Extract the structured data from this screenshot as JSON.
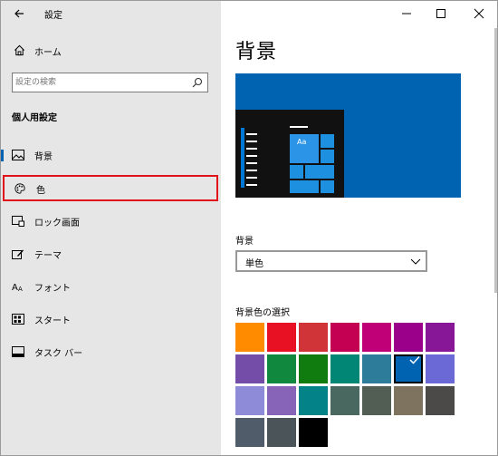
{
  "window": {
    "app_title": "設定",
    "controls": {
      "minimize": "minimize-icon",
      "maximize": "maximize-icon",
      "close": "close-icon"
    }
  },
  "sidebar": {
    "home_label": "ホーム",
    "search_placeholder": "設定の検索",
    "section_title": "個人用設定",
    "items": [
      {
        "label": "背景",
        "icon": "image-icon"
      },
      {
        "label": "色",
        "icon": "palette-icon",
        "highlighted": true
      },
      {
        "label": "ロック画面",
        "icon": "lock-screen-icon"
      },
      {
        "label": "テーマ",
        "icon": "theme-icon"
      },
      {
        "label": "フォント",
        "icon": "font-icon"
      },
      {
        "label": "スタート",
        "icon": "start-icon"
      },
      {
        "label": "タスク バー",
        "icon": "taskbar-icon"
      }
    ]
  },
  "main": {
    "page_title": "背景",
    "preview": {
      "tile_text": "Aa",
      "accent": "#0063b1"
    },
    "background_label": "背景",
    "background_value": "単色",
    "colors_label": "背景色の選択",
    "colors": [
      [
        "#ff8c00",
        "#e81123",
        "#d13438",
        "#c30052",
        "#bf0077",
        "#9a0089",
        "#881798"
      ],
      [
        "#744da9",
        "#10893e",
        "#107c10",
        "#018574",
        "#2d7d9a",
        "#0063b1",
        "#6b69d6"
      ],
      [
        "#8e8cd8",
        "#8764b8",
        "#038387",
        "#486860",
        "#525e54",
        "#7e735f",
        "#4c4a48"
      ],
      [
        "#515c6b",
        "#4a5459",
        "#000000"
      ]
    ],
    "selected_color": "#0063b1"
  }
}
